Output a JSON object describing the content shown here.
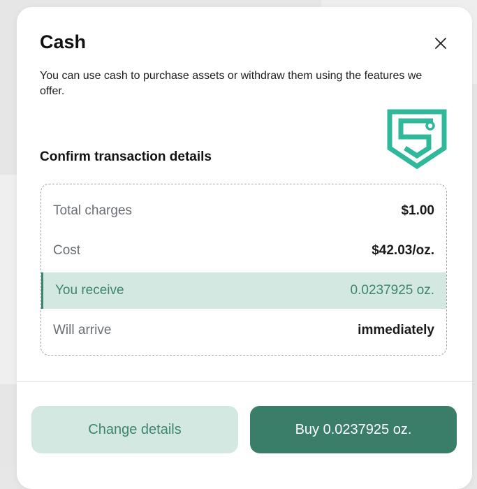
{
  "modal": {
    "title": "Cash",
    "description": "You can use cash to purchase assets or withdraw them using the features we offer.",
    "section_title": "Confirm transaction details",
    "close_icon": "close-icon",
    "brand_icon": "shield-s-logo-icon"
  },
  "details": {
    "rows": [
      {
        "label": "Total charges",
        "value": "$1.00"
      },
      {
        "label": "Cost",
        "value": "$42.03/oz."
      },
      {
        "label": "You receive",
        "value": "0.0237925 oz."
      },
      {
        "label": "Will arrive",
        "value": "immediately"
      }
    ],
    "highlight_row": 2
  },
  "actions": {
    "secondary_label": "Change details",
    "primary_label": "Buy 0.0237925 oz."
  },
  "colors": {
    "accent": "#3a7e6a",
    "accent_light": "#d3e8e0",
    "logo": "#2fb89a"
  }
}
